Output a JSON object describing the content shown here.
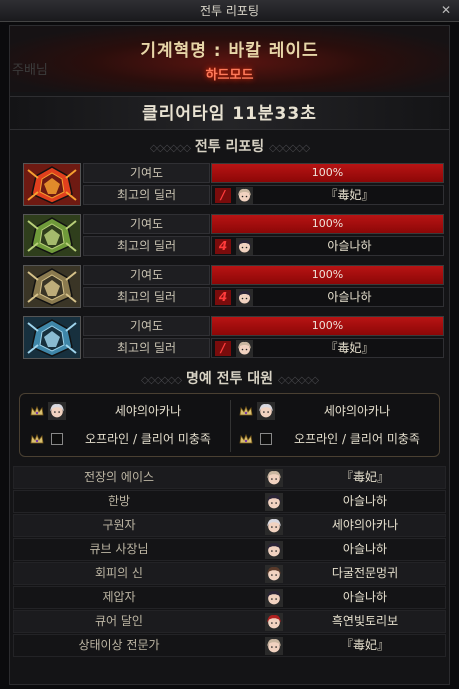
{
  "window": {
    "title": "전투 리포팅",
    "close_label": "✕"
  },
  "banner": {
    "raid_name": "기계혁명 : 바칼 레이드",
    "mode": "하드모드",
    "ghost_text": "주배님"
  },
  "clear": {
    "text": "클리어타임    11분33초"
  },
  "sections": {
    "battle_report": "전투 리포팅",
    "honor": "명예 전투 대원"
  },
  "parties": [
    {
      "emblem": "red-mech-emblem",
      "contribution_label": "기여도",
      "contribution": 100,
      "contribution_text": "100%",
      "dealer_label": "최고의 딜러",
      "class_mark": "/",
      "dealer_name": "『毒妃』"
    },
    {
      "emblem": "green-mech-emblem",
      "contribution_label": "기여도",
      "contribution": 100,
      "contribution_text": "100%",
      "dealer_label": "최고의 딜러",
      "class_mark": "4",
      "dealer_name": "아슬나하"
    },
    {
      "emblem": "gold-mech-emblem",
      "contribution_label": "기여도",
      "contribution": 100,
      "contribution_text": "100%",
      "dealer_label": "최고의 딜러",
      "class_mark": "4",
      "dealer_name": "아슬나하"
    },
    {
      "emblem": "blue-mech-emblem",
      "contribution_label": "기여도",
      "contribution": 100,
      "contribution_text": "100%",
      "dealer_label": "최고의 딜러",
      "class_mark": "/",
      "dealer_name": "『毒妃』"
    }
  ],
  "honor_members": [
    {
      "name": "세야의아카나",
      "status": "member"
    },
    {
      "name": "세야의아카나",
      "status": "member"
    },
    {
      "name": "오프라인 / 클리어 미충족",
      "status": "empty"
    },
    {
      "name": "오프라인 / 클리어 미충족",
      "status": "empty"
    }
  ],
  "awards": [
    {
      "title": "전장의 에이스",
      "name": "『毒妃』"
    },
    {
      "title": "한방",
      "name": "아슬나하"
    },
    {
      "title": "구원자",
      "name": "세야의아카나"
    },
    {
      "title": "큐브 사장님",
      "name": "아슬나하"
    },
    {
      "title": "회피의 신",
      "name": "다굴전문멍귀"
    },
    {
      "title": "제압자",
      "name": "아슬나하"
    },
    {
      "title": "큐어 달인",
      "name": "흑연빛토리보"
    },
    {
      "title": "상태이상 전문가",
      "name": "『毒妃』"
    }
  ],
  "colors": {
    "accent_red": "#b81414",
    "mode_text": "#ff7a5a",
    "gold_text": "#e7d6a8"
  }
}
